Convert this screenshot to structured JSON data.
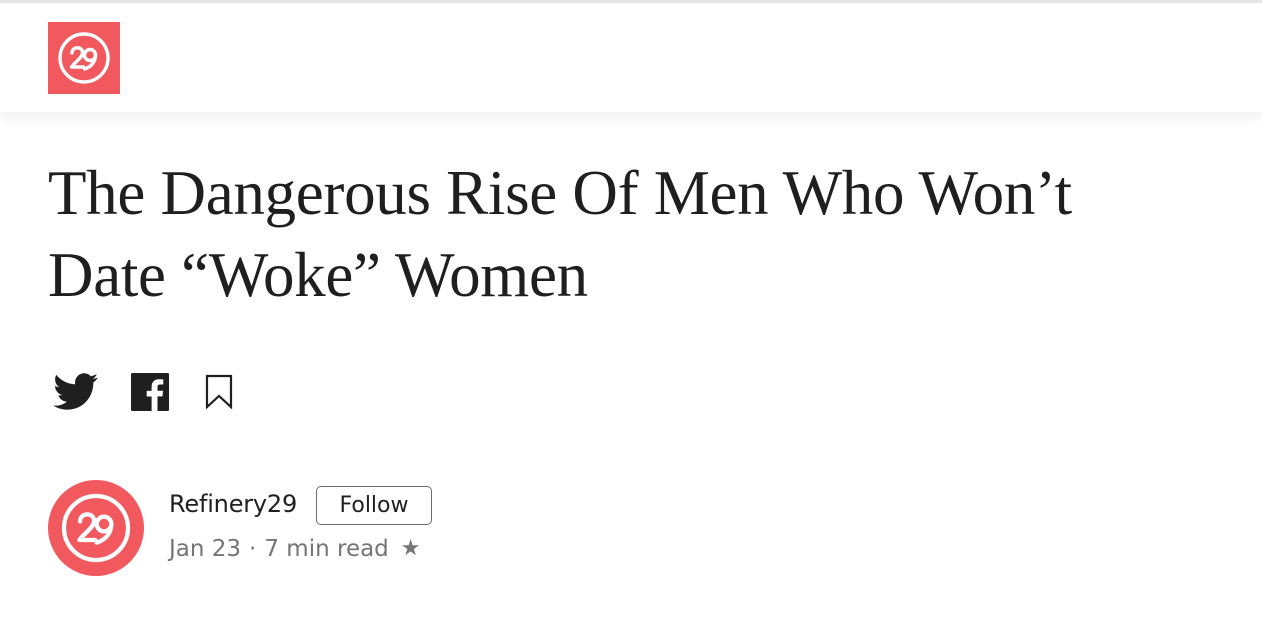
{
  "header": {
    "logo_icon": "refinery29-logo-icon",
    "logo_color": "#f1595e"
  },
  "article": {
    "title": "The Dangerous Rise Of Men Who Won’t Date “Woke” Women"
  },
  "share": {
    "icons": [
      "twitter-icon",
      "facebook-icon",
      "bookmark-icon"
    ]
  },
  "author": {
    "name": "Refinery29",
    "follow_label": "Follow",
    "date": "Jan 23",
    "separator": "·",
    "read_time": "7 min read",
    "star": "★",
    "avatar_icon": "refinery29-logo-icon"
  },
  "colors": {
    "brand": "#f1595e",
    "text": "#1f1f1f",
    "muted": "#757575"
  }
}
